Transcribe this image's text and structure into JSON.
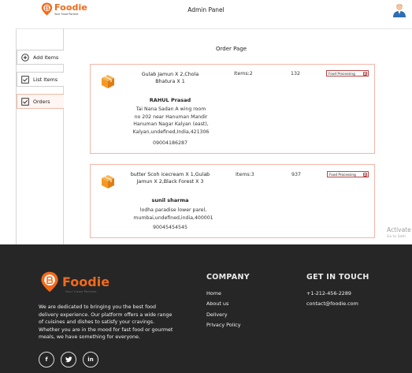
{
  "header": {
    "logo_name": "Foodie",
    "logo_tagline": "Your Food Partner",
    "title": "Admin Panel"
  },
  "sidebar": {
    "items": [
      {
        "label": "Add Items",
        "icon": "plus-circle-icon"
      },
      {
        "label": "List Items",
        "icon": "checkbox-icon"
      },
      {
        "label": "Orders",
        "icon": "checkbox-icon"
      }
    ],
    "active": "Orders"
  },
  "main": {
    "title": "Order Page",
    "orders": [
      {
        "items_line1": "Gulab Jamun X 2,Chola",
        "items_line2": "Bhatura X 1",
        "count": "Items:2",
        "amount": "132",
        "status": "Food Processing",
        "customer": "RAHUL Prasad",
        "address_lines": [
          "Tai Nana Sadan A wing room",
          "no 202 near Hanuman Mandir",
          "Hanuman Nagar Kalyan (east),",
          "Kalyan,undefined,India,421306"
        ],
        "phone": "09004186287"
      },
      {
        "items_line1": "butter Scoh icecream X 1,Gulab",
        "items_line2": "Jamun X 2,Black Forest X 3",
        "count": "Items:3",
        "amount": "937",
        "status": "Food Processing",
        "customer": "sunil sharma",
        "address_lines": [
          "lodha paradise lower parel,",
          "mumbai,undefined,india,400001"
        ],
        "phone": "90045454545"
      }
    ]
  },
  "overlay": {
    "activate_title": "Activate",
    "activate_sub": "Go to Setti"
  },
  "footer": {
    "logo_name": "Foodie",
    "logo_tagline": "Your Food Partner",
    "description": "We are dedicated to bringing you the best food delivery experience. Our platform offers a wide range of cuisines and dishes to satisfy your cravings. Whether you are in the mood for fast food or gourmet meals, we have something for everyone.",
    "socials": [
      "f",
      "t",
      "in"
    ],
    "company_title": "COMPANY",
    "company_links": [
      "Home",
      "About us",
      "Delivery",
      "Privacy Policy"
    ],
    "contact_title": "GET IN TOUCH",
    "phone": "+1-212-456-2289",
    "email": "contact@foodie.com"
  },
  "colors": {
    "brand": "#f26a1b",
    "card_border": "#f2b6a9",
    "footer_bg": "#262626"
  }
}
